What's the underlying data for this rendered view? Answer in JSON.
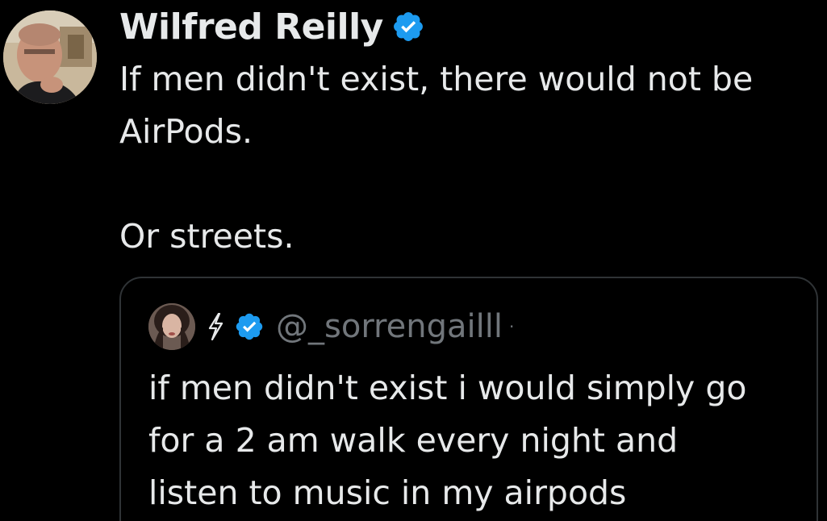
{
  "author": {
    "name": "Wilfred Reilly",
    "verified": true,
    "avatar_icon": "avatar-photo-man"
  },
  "tweet": {
    "line1": "If men didn't exist, there would not be",
    "line2": "AirPods.",
    "line3": "Or streets."
  },
  "quoted_tweet": {
    "handle": "@_sorrengailll",
    "dot": "·",
    "verified": true,
    "emoji_icon": "lightning-bolt-icon",
    "avatar_icon": "avatar-photo-woman",
    "line1": "if men didn't exist i would simply go",
    "line2": "for a 2 am walk every night and",
    "line3": "listen to music in my airpods"
  },
  "colors": {
    "background": "#000000",
    "text": "#e7e9ea",
    "muted": "#71767b",
    "border": "#2f3336",
    "verified_blue": "#1d9bf0"
  }
}
